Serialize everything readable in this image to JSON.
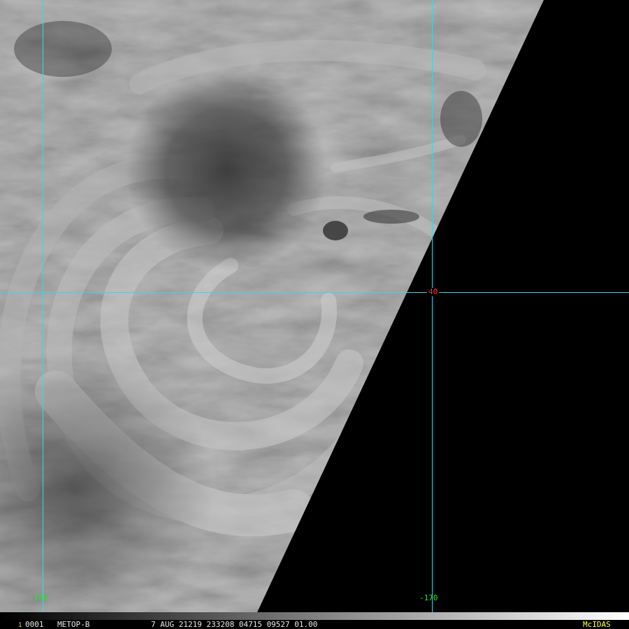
{
  "grid": {
    "color": "#3ad6e6",
    "lon_left": "-185",
    "lon_right": "-170",
    "lat": "40",
    "lon_label_color": "#33dd33",
    "lat_label_color": "#ff2a2a"
  },
  "status_bar": {
    "frame_marker": "1",
    "frame_id": "0001",
    "satellite": "METOP-B",
    "date_time": "7 AUG 21219 233208 04715 09527 01.00",
    "software": "McIDAS",
    "text_color": "#e8e8e8",
    "marker_color": "#ffd800",
    "software_color": "#ffff40"
  },
  "imagery": {
    "type": "grayscale satellite cloud image",
    "no_data_color": "#000000"
  }
}
